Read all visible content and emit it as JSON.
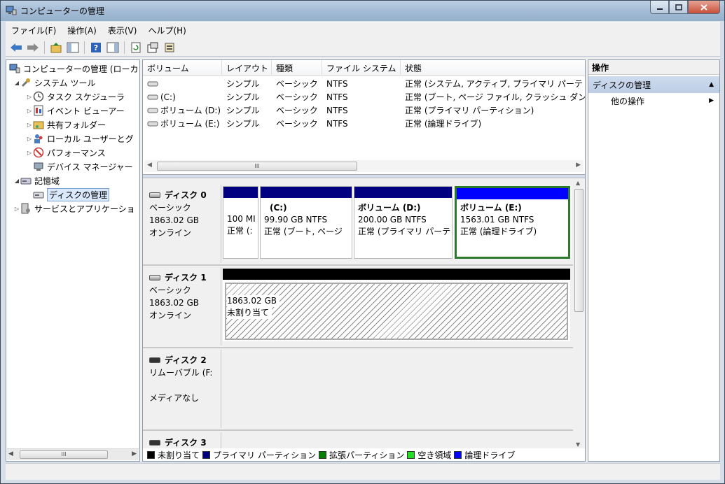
{
  "window": {
    "title": "コンピューターの管理",
    "min": "0",
    "max": "1",
    "close": "X"
  },
  "menu": [
    "ファイル(F)",
    "操作(A)",
    "表示(V)",
    "ヘルプ(H)"
  ],
  "tree": {
    "root": "コンピューターの管理 (ローカ",
    "items": [
      {
        "label": "システム ツール",
        "indent": 1,
        "arrow": "◢"
      },
      {
        "label": "タスク スケジューラ",
        "indent": 2,
        "arrow": "▷"
      },
      {
        "label": "イベント ビューアー",
        "indent": 2,
        "arrow": "▷"
      },
      {
        "label": "共有フォルダー",
        "indent": 2,
        "arrow": "▷"
      },
      {
        "label": "ローカル ユーザーとグ",
        "indent": 2,
        "arrow": "▷"
      },
      {
        "label": "パフォーマンス",
        "indent": 2,
        "arrow": "▷"
      },
      {
        "label": "デバイス マネージャー",
        "indent": 2,
        "arrow": ""
      },
      {
        "label": "記憶域",
        "indent": 1,
        "arrow": "◢"
      },
      {
        "label": "ディスクの管理",
        "indent": 2,
        "arrow": ""
      },
      {
        "label": "サービスとアプリケーショ",
        "indent": 1,
        "arrow": "▷"
      }
    ],
    "scroll_label": "III"
  },
  "volumes": {
    "columns": [
      "ボリューム",
      "レイアウト",
      "種類",
      "ファイル システム",
      "状態"
    ],
    "rows": [
      [
        "",
        "シンプル",
        "ベーシック",
        "NTFS",
        "正常 (システム, アクティブ, プライマリ パーテ"
      ],
      [
        "(C:)",
        "シンプル",
        "ベーシック",
        "NTFS",
        "正常 (ブート, ページ ファイル, クラッシュ ダン"
      ],
      [
        "ボリューム (D:)",
        "シンプル",
        "ベーシック",
        "NTFS",
        "正常 (プライマリ パーティション)"
      ],
      [
        "ボリューム (E:)",
        "シンプル",
        "ベーシック",
        "NTFS",
        "正常 (論理ドライブ)"
      ]
    ],
    "scroll_label": "III"
  },
  "disks": [
    {
      "name": "ディスク 0",
      "type": "ベーシック",
      "size": "1863.02 GB",
      "status": "オンライン",
      "parts": [
        {
          "title": "",
          "size": "100 MI",
          "status": "正常 (:"
        },
        {
          "title": "(C:)",
          "size": "99.90 GB NTFS",
          "status": "正常 (ブート, ページ"
        },
        {
          "title": "ボリューム (D:)",
          "size": "200.00 GB NTFS",
          "status": "正常 (プライマリ パーテ"
        },
        {
          "title": "ボリューム (E:)",
          "size": "1563.01 GB NTFS",
          "status": "正常 (論理ドライブ)"
        }
      ]
    },
    {
      "name": "ディスク 1",
      "type": "ベーシック",
      "size": "1863.02 GB",
      "status": "オンライン",
      "parts": [
        {
          "title": "",
          "size": "1863.02 GB",
          "status": "未割り当て"
        }
      ]
    },
    {
      "name": "ディスク 2",
      "type": "リムーバブル (F:",
      "size": "",
      "status": "メディアなし"
    },
    {
      "name": "ディスク 3"
    }
  ],
  "legend": [
    "未割り当て",
    "プライマリ パーティション",
    "拡張パーティション",
    "空き領域",
    "論理ドライブ"
  ],
  "colors": {
    "unallocated": "#000000",
    "primary": "#000080",
    "extended": "#008000",
    "free": "#22dd22",
    "logical": "#0000ff"
  },
  "actions": {
    "title": "操作",
    "section": "ディスクの管理",
    "more": "他の操作"
  }
}
